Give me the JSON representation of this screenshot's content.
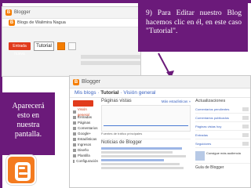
{
  "slide": {
    "callout_top_right": "9) Para Editar nuestro Blog hacemos clic en él, en este caso \"Tutorial\".",
    "callout_left_lines": [
      "Aparecerá",
      "esto en",
      "nuestra",
      "pantalla."
    ]
  },
  "back_screenshot": {
    "brand": "Blogger",
    "blog_name": "Blogs de Walimira Nagua",
    "selected_blog": "Tutorial",
    "new_post": "Entrada nueva"
  },
  "dashboard": {
    "brand": "Blogger",
    "blog_title": "Mis blogs",
    "breadcrumb_current": "Tutorial",
    "breadcrumb_view": "Visión general",
    "sidebar": [
      "Visión general",
      "Entradas",
      "Páginas",
      "Comentarios",
      "Google+",
      "Estadísticas",
      "Ingresos",
      "Diseño",
      "Plantilla",
      "Configuración"
    ],
    "pageviews_title": "Páginas vistas",
    "pageviews_more": "Más estadísticas »",
    "pageviews_foot": "Fuentes de tráfico principales",
    "news_title": "Noticias de Blogger",
    "updates_title": "Actualizaciones",
    "updates": [
      "Comentarios pendientes",
      "Comentarios publicados",
      "Páginas vistas hoy",
      "Entradas",
      "Seguidores"
    ],
    "promo": "Consigue más audiencia",
    "guide": "Guía de Blogger"
  },
  "colors": {
    "slide_purple": "#6b1a7a",
    "blogger_orange": "#f57d00",
    "new_post_red": "#e13b1c"
  }
}
